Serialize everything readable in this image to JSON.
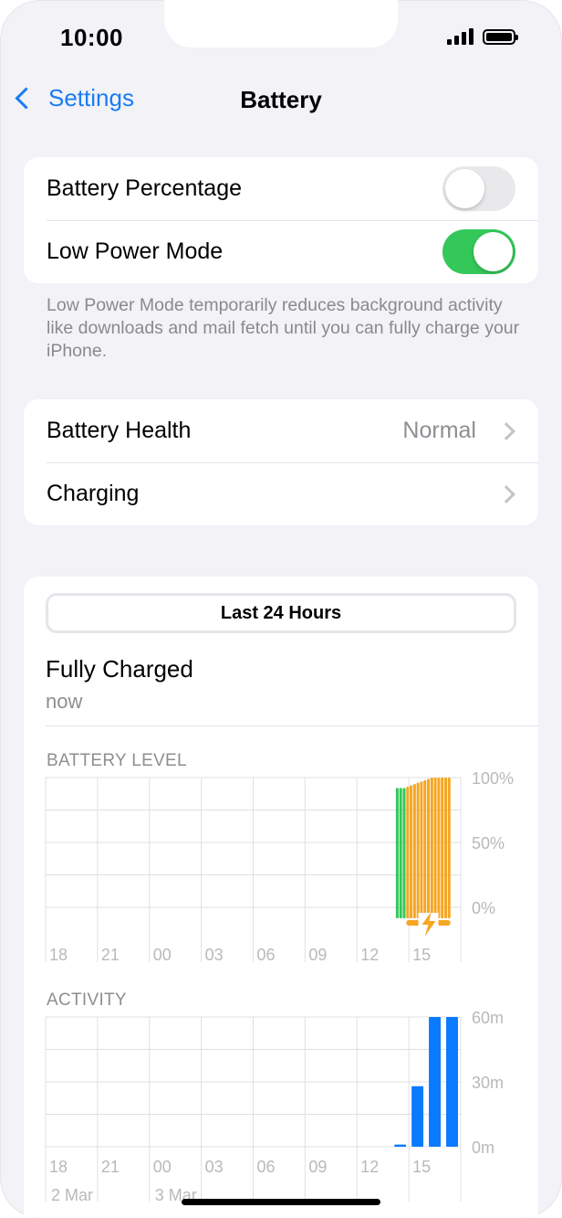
{
  "status_bar": {
    "time": "10:00"
  },
  "nav": {
    "back_label": "Settings",
    "title": "Battery"
  },
  "settings": {
    "battery_percentage": {
      "label": "Battery Percentage",
      "on": false
    },
    "low_power_mode": {
      "label": "Low Power Mode",
      "on": true
    },
    "low_power_footnote": "Low Power Mode temporarily reduces background activity like downloads and mail fetch until you can fully charge your iPhone."
  },
  "health": {
    "battery_health_label": "Battery Health",
    "battery_health_value": "Normal",
    "charging_label": "Charging"
  },
  "usage": {
    "range_button": "Last 24 Hours",
    "charge_status": "Fully Charged",
    "charge_time": "now"
  },
  "colors": {
    "accent": "#1a7cf5",
    "toggle_on": "#34c759",
    "battery_green": "#34c759",
    "charging_orange": "#f5a623",
    "activity_blue": "#0a7aff"
  },
  "chart_data": [
    {
      "type": "bar",
      "title": "BATTERY LEVEL",
      "x_ticks": [
        "18",
        "21",
        "00",
        "03",
        "06",
        "09",
        "12",
        "15"
      ],
      "y_ticks": [
        "100%",
        "50%",
        "0%"
      ],
      "ylim": [
        0,
        100
      ],
      "grid": true,
      "bars": [
        {
          "t": 13.25,
          "value": 92,
          "state": "battery"
        },
        {
          "t": 13.45,
          "value": 92,
          "state": "battery"
        },
        {
          "t": 13.65,
          "value": 92,
          "state": "battery"
        },
        {
          "t": 13.85,
          "value": 93,
          "state": "charging"
        },
        {
          "t": 14.05,
          "value": 94,
          "state": "charging"
        },
        {
          "t": 14.25,
          "value": 95,
          "state": "charging"
        },
        {
          "t": 14.45,
          "value": 96,
          "state": "charging"
        },
        {
          "t": 14.65,
          "value": 97,
          "state": "charging"
        },
        {
          "t": 14.85,
          "value": 98,
          "state": "charging"
        },
        {
          "t": 15.05,
          "value": 99,
          "state": "charging"
        },
        {
          "t": 15.25,
          "value": 100,
          "state": "charging"
        },
        {
          "t": 15.45,
          "value": 100,
          "state": "charging"
        },
        {
          "t": 15.65,
          "value": 100,
          "state": "charging"
        },
        {
          "t": 15.85,
          "value": 100,
          "state": "charging"
        },
        {
          "t": 16.05,
          "value": 100,
          "state": "charging"
        },
        {
          "t": 16.25,
          "value": 100,
          "state": "charging"
        }
      ],
      "charging_indicator": true
    },
    {
      "type": "bar",
      "title": "ACTIVITY",
      "x_ticks": [
        "18",
        "21",
        "00",
        "03",
        "06",
        "09",
        "12",
        "15"
      ],
      "date_labels": [
        "2 Mar",
        "3 Mar"
      ],
      "y_ticks": [
        "60m",
        "30m",
        "0m"
      ],
      "ylim": [
        0,
        60
      ],
      "grid": true,
      "bars": [
        {
          "hour": 13,
          "minutes": 1
        },
        {
          "hour": 14,
          "minutes": 28
        },
        {
          "hour": 15,
          "minutes": 60
        },
        {
          "hour": 16,
          "minutes": 60
        }
      ]
    }
  ]
}
